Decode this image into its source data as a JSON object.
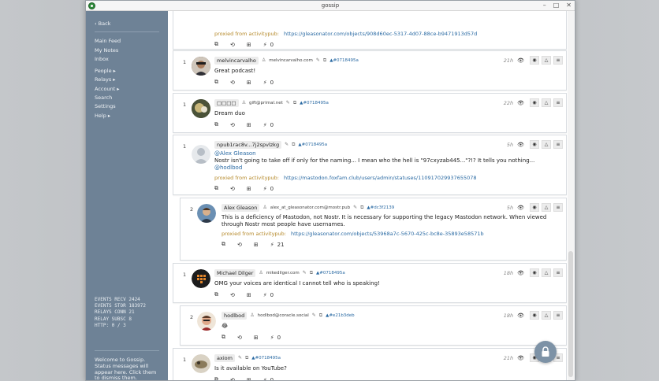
{
  "window": {
    "title": "gossip",
    "controls": [
      "–",
      "□",
      "✕"
    ]
  },
  "sidebar": {
    "back": "‹ Back",
    "items": [
      "Main Feed",
      "My Notes",
      "Inbox"
    ],
    "items2": [
      "People ▸",
      "Relays ▸",
      "Account ▸",
      "Search",
      "Settings",
      "Help ▸"
    ],
    "stats": [
      "EVENTS RECV 2424",
      "EVENTS STOR 183972",
      "RELAYS CONN 21",
      "RELAY SUBSC 8",
      "HTTP: 0 / 3"
    ],
    "status": "Welcome to Gossip. Status messages will appear here. Click them to dismiss them."
  },
  "notes": [
    {
      "num": "",
      "proxied_label": "proxied from activitypub:",
      "proxied_url": "https://gleasonator.com/objects/908d60ec-5317-4d07-88ce-b9471913d57d",
      "zaps": "0"
    },
    {
      "num": "1",
      "name": "melvincarvalho",
      "nip05": "melvincarvalho.com",
      "tag": "▲#0718495a",
      "time": "21h",
      "text": "Great podcast!",
      "zaps": "0"
    },
    {
      "num": "1",
      "name": "□□□□",
      "nip05": "gift@primal.net",
      "tag": "▲#0718495a",
      "time": "22h",
      "text": "Dream duo",
      "zaps": "0"
    },
    {
      "num": "1",
      "name": "npub1rac8v...7j2spvlzkg",
      "tag": "▲#0718495a",
      "time": "5h",
      "mention1": "@Alex Gleason",
      "text": "Nostr isn't going to take off if only for the naming... I mean who the hell is \"97cxyzab445...\"?!? It tells you nothing...",
      "mention2": "@hodlbod",
      "proxied_label": "proxied from activitypub:",
      "proxied_url": "https://mastodon.foxfam.club/users/admin/statuses/110917029937655078",
      "zaps": "0"
    },
    {
      "num": "2",
      "name": "Alex Gleason",
      "nip05": "alex_at_gleasonator.com@mostr.pub",
      "tag": "▲#dc3f2139",
      "time": "5h",
      "text": "This is a deficiency of Mastodon, not Nostr. It is necessary for supporting the legacy Mastodon network. When viewed through Nostr most people have usernames.",
      "proxied_label": "proxied from activitypub:",
      "proxied_url": "https://gleasonator.com/objects/53968a7c-5670-425c-bc8e-35893e58571b",
      "zaps": "21"
    },
    {
      "num": "1",
      "name": "Michael Dilger",
      "nip05": "mikedilger.com",
      "tag": "▲#0718495a",
      "time": "18h",
      "text": "OMG your voices are identical I cannot tell who is speaking!",
      "zaps": "0"
    },
    {
      "num": "2",
      "name": "hodlbod",
      "nip05": "hodlbod@coracle.social",
      "tag": "▲#e21b3deb",
      "time": "18h",
      "text": "😂",
      "zaps": "0"
    },
    {
      "num": "1",
      "name": "axiom",
      "tag": "▲#0718495a",
      "time": "21h",
      "text": "Is it available on YouTube?",
      "zaps": "0"
    }
  ],
  "colors": {
    "sidebar": "#6e8296",
    "link": "#2a6aa3",
    "proxied": "#b5892a"
  }
}
